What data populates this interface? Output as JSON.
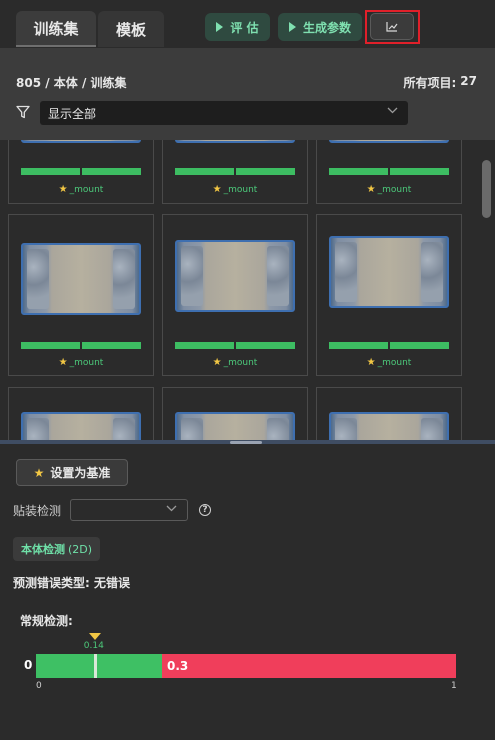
{
  "tabs": [
    {
      "label": "训练集",
      "active": true
    },
    {
      "label": "模板",
      "active": false
    }
  ],
  "toolbar": {
    "evaluate_label": "评 估",
    "generate_params_label": "生成参数",
    "chart_icon": "line-chart-icon"
  },
  "header": {
    "breadcrumb": "805 / 本体 / 训练集",
    "count_label": "所有项目:",
    "count_value": "27",
    "filter_icon": "funnel-icon",
    "filter_value": "显示全部"
  },
  "gallery": {
    "items": [
      {
        "label": "_mount"
      },
      {
        "label": "_mount"
      },
      {
        "label": "_mount"
      },
      {
        "label": "_mount"
      },
      {
        "label": "_mount"
      },
      {
        "label": "_mount"
      },
      {
        "label": ""
      },
      {
        "label": ""
      },
      {
        "label": ""
      }
    ]
  },
  "panel": {
    "baseline_button": "设置为基准",
    "mount_label": "贴装检测",
    "mount_value": "",
    "body_tab_label": "本体检测",
    "body_tab_sub": "(2D)",
    "predicted_type": "预测错误类型: 无错误",
    "regular_title": "常规检测:",
    "gauge": {
      "value": 0.14,
      "value_label": "0.14",
      "threshold": 0.3,
      "threshold_label": "0.3",
      "axis_label": "0",
      "min_label": "0",
      "max_label": "1",
      "ok_color": "#3ec064",
      "ng_color": "#f03e5b"
    }
  }
}
